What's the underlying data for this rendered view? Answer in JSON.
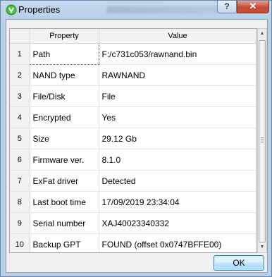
{
  "window": {
    "title": "Properties",
    "help_label": "?",
    "close_label": "✕",
    "icon": "shield-check-icon"
  },
  "grid": {
    "columns": {
      "property": "Property",
      "value": "Value"
    },
    "rows": [
      {
        "index": "1",
        "property": "Path",
        "value": "F:/c731c053/rawnand.bin"
      },
      {
        "index": "2",
        "property": "NAND type",
        "value": "RAWNAND"
      },
      {
        "index": "3",
        "property": "File/Disk",
        "value": "File"
      },
      {
        "index": "4",
        "property": "Encrypted",
        "value": "Yes"
      },
      {
        "index": "5",
        "property": "Size",
        "value": "29.12 Gb"
      },
      {
        "index": "6",
        "property": "Firmware ver.",
        "value": "8.1.0"
      },
      {
        "index": "7",
        "property": "ExFat driver",
        "value": "Detected"
      },
      {
        "index": "8",
        "property": "Last boot time",
        "value": "17/09/2019 23:34:04"
      },
      {
        "index": "9",
        "property": "Serial number",
        "value": "XAJ40023340332"
      },
      {
        "index": "10",
        "property": "Backup GPT",
        "value": "FOUND (offset 0x0747BFFE00)"
      }
    ]
  },
  "buttons": {
    "ok": "OK"
  },
  "colors": {
    "close_red": "#c44a35",
    "title_bg": "#b9d1ea",
    "ok_border": "#3c7fb1"
  }
}
